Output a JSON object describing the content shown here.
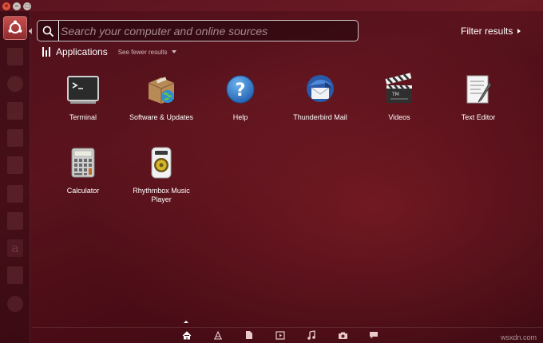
{
  "window": {
    "buttons": [
      "×",
      "–",
      "□"
    ]
  },
  "search": {
    "placeholder": "Search your computer and online sources",
    "value": ""
  },
  "filter": {
    "label": "Filter results"
  },
  "category": {
    "title": "Applications",
    "toggle_label": "See fewer results"
  },
  "apps": [
    {
      "name": "Terminal",
      "icon": "terminal-icon"
    },
    {
      "name": "Software & Updates",
      "icon": "software-updates-icon"
    },
    {
      "name": "Help",
      "icon": "help-icon"
    },
    {
      "name": "Thunderbird Mail",
      "icon": "thunderbird-icon"
    },
    {
      "name": "Videos",
      "icon": "videos-icon"
    },
    {
      "name": "Text Editor",
      "icon": "text-editor-icon"
    },
    {
      "name": "Calculator",
      "icon": "calculator-icon"
    },
    {
      "name": "Rhythmbox Music Player",
      "icon": "rhythmbox-icon"
    }
  ],
  "lenses": [
    "home-lens-icon",
    "applications-lens-icon",
    "files-lens-icon",
    "video-lens-icon",
    "music-lens-icon",
    "photo-lens-icon",
    "social-lens-icon"
  ],
  "launcher": {
    "items": [
      "dash-home-icon",
      "files-icon",
      "firefox-icon",
      "libreoffice-writer-icon",
      "libreoffice-calc-icon",
      "libreoffice-impress-icon",
      "software-center-icon",
      "ubuntu-one-icon",
      "amazon-icon",
      "ubuntu-one-music-icon",
      "system-settings-icon"
    ]
  },
  "watermark": "wsxdn.com",
  "colors": {
    "accent": "#c8504c",
    "background": "#5b1420"
  }
}
